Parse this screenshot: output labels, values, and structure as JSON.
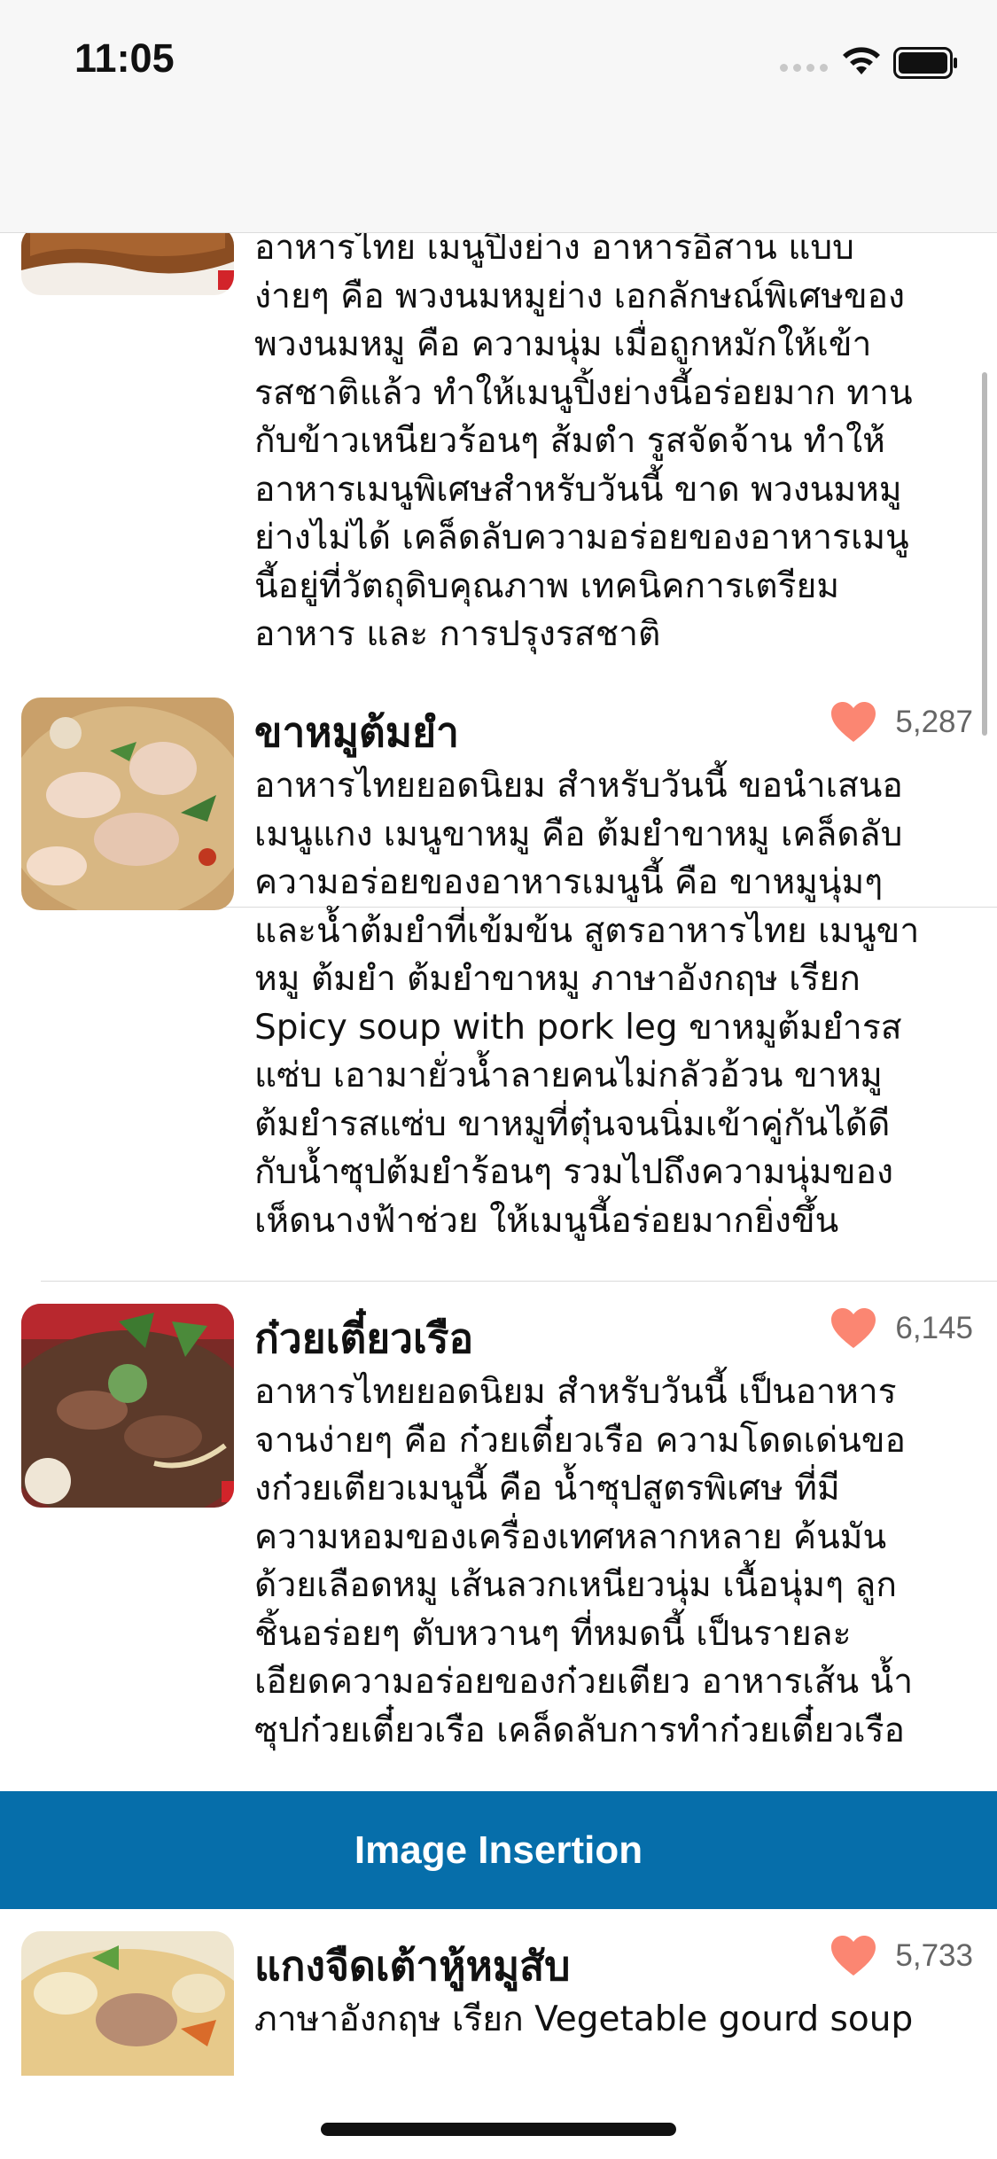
{
  "status_bar": {
    "time": "11:05"
  },
  "recipes": [
    {
      "title": "",
      "likes": "",
      "description": "อาหารไทย เมนูปิ้งย่าง อาหารอิสาน แบบ\nง่ายๆ คือ พวงนมหมูย่าง เอกลักษณ์พิเศษของ\nพวงนมหมู คือ ความนุ่ม เมื่อถูกหมักให้เข้า\nรสชาติแล้ว ทำให้เมนูปิ้งย่างนี้อร่อยมาก ทาน\nกับข้าวเหนียวร้อนๆ ส้มตำ รูสจัดจ้าน ทำให้\nอาหารเมนูพิเศษสำหรับวันนี้ ขาด พวงนมหมู\nย่างไม่ได้ เคล็ดลับความอร่อยของอาหารเมนู\nนี้อยู่ที่วัตถุดิบคุณภาพ เทคนิคการเตรียม\nอาหาร และ การปรุงรสชาติ"
    },
    {
      "title": "ขาหมูต้มยำ",
      "likes": "5,287",
      "description": "อาหารไทยยอดนิยม สำหรับวันนี้ ขอนำเสนอ\nเมนูแกง เมนูขาหมู คือ ต้มยำขาหมู เคล็ดลับ\nความอร่อยของอาหารเมนูนี้ คือ ขาหมูนุ่มๆ\nและน้ำต้มยำที่เข้มข้น สูตรอาหารไทย เมนูขา\nหมู ต้มยำ ต้มยำขาหมู ภาษาอังกฤษ เรียก\nSpicy soup with pork leg ขาหมูต้มยำรส\nแซ่บ เอามายั่วน้ำลายคนไม่กลัวอ้วน ขาหมู\nต้มยำรสแซ่บ ขาหมูที่ตุ๋นจนนิ่มเข้าคู่กันได้ดี\nกับน้ำซุปต้มยำร้อนๆ รวมไปถึงความนุ่มของ\nเห็ดนางฟ้าช่วย ให้เมนูนี้อร่อยมากยิ่งขึ้น"
    },
    {
      "title": "ก๋วยเตี๋ยวเรือ",
      "likes": "6,145",
      "description": "อาหารไทยยอดนิยม สำหรับวันนี้ เป็นอาหาร\nจานง่ายๆ คือ ก๋วยเตี๋ยวเรือ ความโดดเด่นขอ\nงก๋วยเตียวเมนูนี้ คือ น้ำซุปสูตรพิเศษ ที่มี\nความหอมของเครื่องเทศหลากหลาย ค้นมัน\nด้วยเลือดหมู เส้นลวกเหนียวนุ่ม เนื้อนุ่มๆ ลูก\nชิ้นอร่อยๆ ตับหวานๆ ที่หมดนี้ เป็นรายละ\nเอียดความอร่อยของก๋วยเตียว อาหารเส้น น้ำ\nซุปก๋วยเตี๋ยวเรือ เคล็ดลับการทำก๋วยเตี๋ยวเรือ"
    },
    {
      "title": "แกงจืดเต้าหู้หมูสับ",
      "likes": "5,733",
      "description": "ภาษาอังกฤษ เรียก Vegetable gourd soup"
    }
  ],
  "banner": {
    "label": "Image Insertion"
  },
  "colors": {
    "heart": "#fb8672",
    "banner": "#066eaa"
  }
}
